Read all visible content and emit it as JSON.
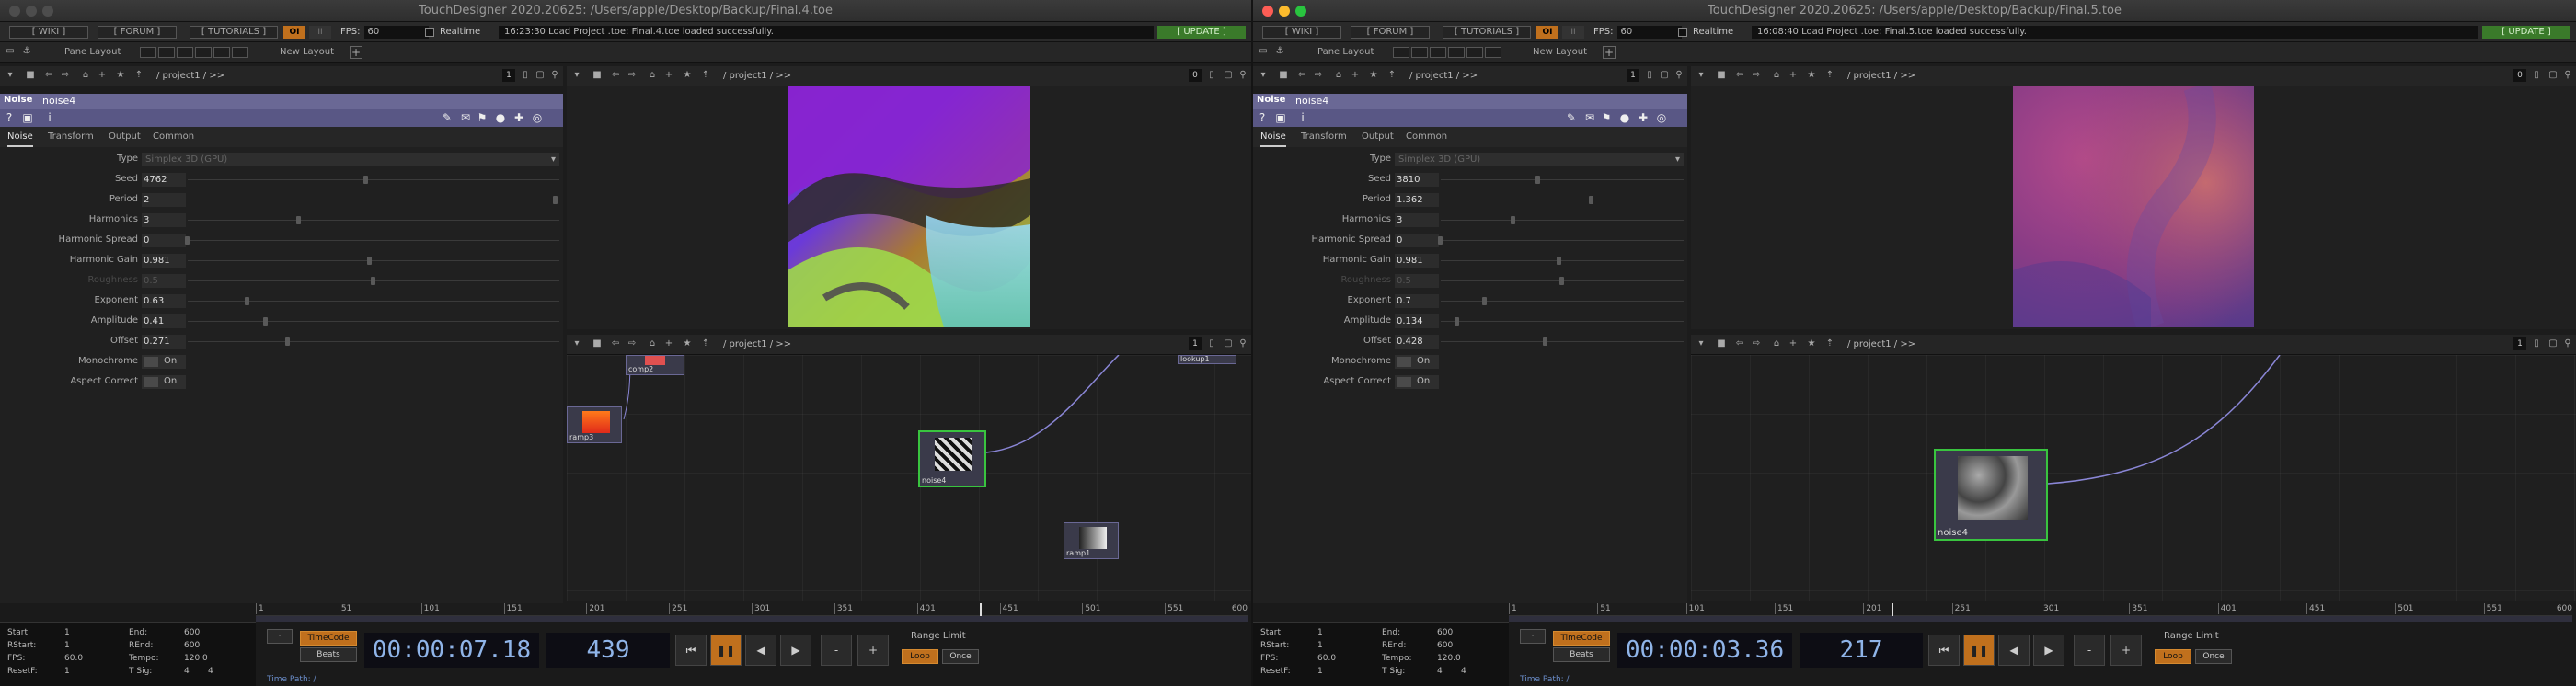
{
  "colors": {
    "accent": "#c0701d",
    "op_bar": "#6a6895",
    "selected": "#39c43f",
    "update": "#3a7a2a"
  },
  "windows": [
    {
      "title": "TouchDesigner 2020.20625: /Users/apple/Desktop/Backup/Final.4.toe",
      "menu": {
        "wiki": "[ WIKI ]",
        "forum": "[ FORUM ]",
        "tutorials": "[ TUTORIALS ]",
        "oi": "OI",
        "ii": "II",
        "fps_label": "FPS:",
        "fps_value": "60",
        "realtime": "Realtime",
        "status": "16:23:30 Load Project .toe: Final.4.toe loaded successfully.",
        "update": "[ UPDATE ]"
      },
      "layout": {
        "pane_layout": "Pane Layout",
        "new_layout": "New Layout",
        "add": "+"
      },
      "param_nav": {
        "path": "/ project1 / >>",
        "pane": "1"
      },
      "viewer_nav": {
        "path": "/ project1 / >>",
        "pane": "0"
      },
      "network_nav": {
        "path": "/ project1 / >>",
        "pane": "1"
      },
      "op": {
        "type": "Noise",
        "name": "noise4"
      },
      "tabs": [
        "Noise",
        "Transform",
        "Output",
        "Common"
      ],
      "params": [
        {
          "label": "Type",
          "kind": "menu",
          "value": "Simplex 3D (GPU)"
        },
        {
          "label": "Seed",
          "value": "4762",
          "slider": 0.48
        },
        {
          "label": "Period",
          "value": "2",
          "slider": 0.99
        },
        {
          "label": "Harmonics",
          "value": "3",
          "slider": 0.3
        },
        {
          "label": "Harmonic Spread",
          "value": "0",
          "slider": 0.0
        },
        {
          "label": "Harmonic Gain",
          "value": "0.981",
          "slider": 0.49
        },
        {
          "label": "Roughness",
          "value": "0.5",
          "slider": 0.5,
          "dim": true
        },
        {
          "label": "Exponent",
          "value": "0.63",
          "slider": 0.16
        },
        {
          "label": "Amplitude",
          "value": "0.41",
          "slider": 0.21
        },
        {
          "label": "Offset",
          "value": "0.271",
          "slider": 0.27
        },
        {
          "label": "Monochrome",
          "kind": "toggle",
          "value": "On"
        },
        {
          "label": "Aspect Correct",
          "kind": "toggle",
          "value": "On"
        }
      ],
      "nodes": [
        {
          "label": "comp2"
        },
        {
          "label": "ramp3"
        },
        {
          "label": "noise4"
        },
        {
          "label": "ramp1"
        },
        {
          "label": "lookup1"
        }
      ],
      "timeline": {
        "ticks": [
          "1",
          "51",
          "101",
          "151",
          "201",
          "251",
          "301",
          "351",
          "401",
          "451",
          "501",
          "551",
          "600"
        ],
        "cursor": 0.73
      },
      "range": {
        "start_l": "Start:",
        "start": "1",
        "end_l": "End:",
        "end": "600",
        "rstart_l": "RStart:",
        "rstart": "1",
        "rend_l": "REnd:",
        "rend": "600",
        "fps_l": "FPS:",
        "fps": "60.0",
        "tempo_l": "Tempo:",
        "tempo": "120.0",
        "resetf_l": "ResetF:",
        "resetf": "1",
        "tsig_l": "T Sig:",
        "tsig_a": "4",
        "tsig_b": "4"
      },
      "transport": {
        "timecode_btn": "TimeCode",
        "beats_btn": "Beats",
        "timecode": "00:00:07.18",
        "frame": "439",
        "range_limit": "Range Limit",
        "loop": "Loop",
        "once": "Once",
        "minus": "-",
        "plus": "+"
      },
      "time_path": "Time Path: /"
    },
    {
      "title": "TouchDesigner 2020.20625: /Users/apple/Desktop/Backup/Final.5.toe",
      "menu": {
        "wiki": "[ WIKI ]",
        "forum": "[ FORUM ]",
        "tutorials": "[ TUTORIALS ]",
        "oi": "OI",
        "ii": "II",
        "fps_label": "FPS:",
        "fps_value": "60",
        "realtime": "Realtime",
        "status": "16:08:40 Load Project .toe: Final.5.toe loaded successfully.",
        "update": "[ UPDATE ]"
      },
      "layout": {
        "pane_layout": "Pane Layout",
        "new_layout": "New Layout",
        "add": "+"
      },
      "param_nav": {
        "path": "/ project1 / >>",
        "pane": "1"
      },
      "viewer_nav": {
        "path": "/ project1 / >>",
        "pane": "0"
      },
      "network_nav": {
        "path": "/ project1 / >>",
        "pane": "1"
      },
      "op": {
        "type": "Noise",
        "name": "noise4"
      },
      "tabs": [
        "Noise",
        "Transform",
        "Output",
        "Common"
      ],
      "params": [
        {
          "label": "Type",
          "kind": "menu",
          "value": "Simplex 3D (GPU)"
        },
        {
          "label": "Seed",
          "value": "3810",
          "slider": 0.4
        },
        {
          "label": "Period",
          "value": "1.362",
          "slider": 0.62
        },
        {
          "label": "Harmonics",
          "value": "3",
          "slider": 0.3
        },
        {
          "label": "Harmonic Spread",
          "value": "0",
          "slider": 0.0
        },
        {
          "label": "Harmonic Gain",
          "value": "0.981",
          "slider": 0.49
        },
        {
          "label": "Roughness",
          "value": "0.5",
          "slider": 0.5,
          "dim": true
        },
        {
          "label": "Exponent",
          "value": "0.7",
          "slider": 0.18
        },
        {
          "label": "Amplitude",
          "value": "0.134",
          "slider": 0.07
        },
        {
          "label": "Offset",
          "value": "0.428",
          "slider": 0.43
        },
        {
          "label": "Monochrome",
          "kind": "toggle",
          "value": "On"
        },
        {
          "label": "Aspect Correct",
          "kind": "toggle",
          "value": "On"
        }
      ],
      "nodes": [
        {
          "label": "noise4"
        }
      ],
      "timeline": {
        "ticks": [
          "1",
          "51",
          "101",
          "151",
          "201",
          "251",
          "301",
          "351",
          "401",
          "451",
          "501",
          "551",
          "600"
        ],
        "cursor": 0.36
      },
      "range": {
        "start_l": "Start:",
        "start": "1",
        "end_l": "End:",
        "end": "600",
        "rstart_l": "RStart:",
        "rstart": "1",
        "rend_l": "REnd:",
        "rend": "600",
        "fps_l": "FPS:",
        "fps": "60.0",
        "tempo_l": "Tempo:",
        "tempo": "120.0",
        "resetf_l": "ResetF:",
        "resetf": "1",
        "tsig_l": "T Sig:",
        "tsig_a": "4",
        "tsig_b": "4"
      },
      "transport": {
        "timecode_btn": "TimeCode",
        "beats_btn": "Beats",
        "timecode": "00:00:03.36",
        "frame": "217",
        "range_limit": "Range Limit",
        "loop": "Loop",
        "once": "Once",
        "minus": "-",
        "plus": "+"
      },
      "time_path": "Time Path: /"
    }
  ]
}
